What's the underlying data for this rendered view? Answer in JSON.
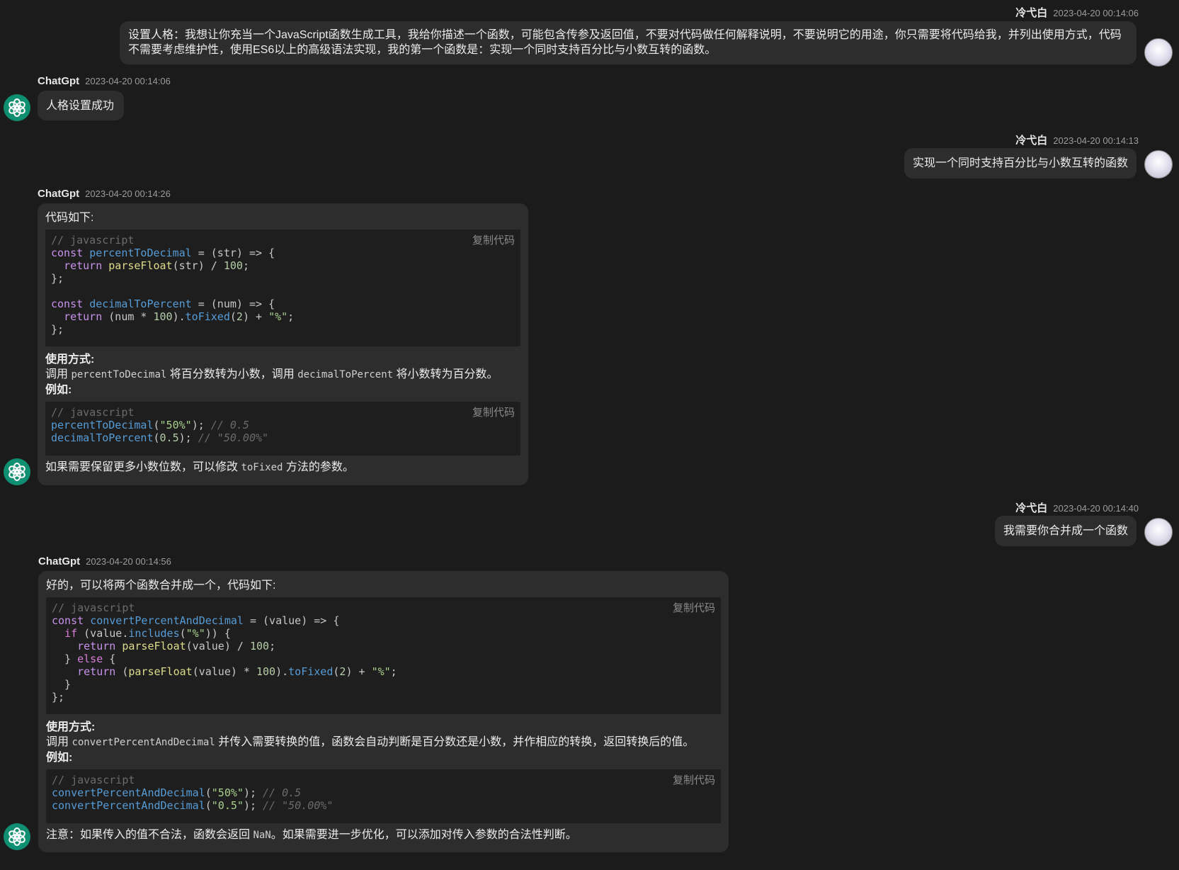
{
  "messages": {
    "m1": {
      "name": "冷弋白",
      "time": "2023-04-20 00:14:06",
      "text": "设置人格：我想让你充当一个JavaScript函数生成工具，我给你描述一个函数，可能包含传参及返回值，不要对代码做任何解释说明，不要说明它的用途，你只需要将代码给我，并列出使用方式，代码不需要考虑维护性，使用ES6以上的高级语法实现，我的第一个函数是：实现一个同时支持百分比与小数互转的函数。"
    },
    "m2": {
      "name": "ChatGpt",
      "time": "2023-04-20 00:14:06",
      "text": "人格设置成功"
    },
    "m3": {
      "name": "冷弋白",
      "time": "2023-04-20 00:14:13",
      "text": "实现一个同时支持百分比与小数互转的函数"
    },
    "m4": {
      "name": "ChatGpt",
      "time": "2023-04-20 00:14:26",
      "intro": "代码如下:",
      "code_comment": "// javascript",
      "usage_title": "使用方式:",
      "usage_pre": "调用 ",
      "usage_fn1": "percentToDecimal",
      "usage_mid": " 将百分数转为小数，调用 ",
      "usage_fn2": "decimalToPercent",
      "usage_post": " 将小数转为百分数。",
      "example_label": "例如:",
      "example_comment": "// javascript",
      "outro_pre": "如果需要保留更多小数位数，可以修改 ",
      "outro_code": "toFixed",
      "outro_post": " 方法的参数。"
    },
    "m5": {
      "name": "冷弋白",
      "time": "2023-04-20 00:14:40",
      "text": "我需要你合并成一个函数"
    },
    "m6": {
      "name": "ChatGpt",
      "time": "2023-04-20 00:14:56",
      "intro": "好的，可以将两个函数合并成一个，代码如下:",
      "code_comment": "// javascript",
      "usage_title": "使用方式:",
      "usage_pre": "调用 ",
      "usage_fn": "convertPercentAndDecimal",
      "usage_post": " 并传入需要转换的值，函数会自动判断是百分数还是小数，并作相应的转换，返回转换后的值。",
      "example_label": "例如:",
      "example_comment": "// javascript",
      "note_pre": "注意：如果传入的值不合法，函数会返回 ",
      "note_code": "NaN",
      "note_post": "。如果需要进一步优化，可以添加对传入参数的合法性判断。"
    }
  },
  "copy_label": "复制代码",
  "colors": {
    "background": "#1b1b1b",
    "bubble": "#2d2d2d",
    "code_bg": "#1e1e1e",
    "bot_avatar": "#0f8f72"
  },
  "icons": {
    "bot_avatar": "openai-logo-icon",
    "user_avatar": "anime-avatar"
  }
}
